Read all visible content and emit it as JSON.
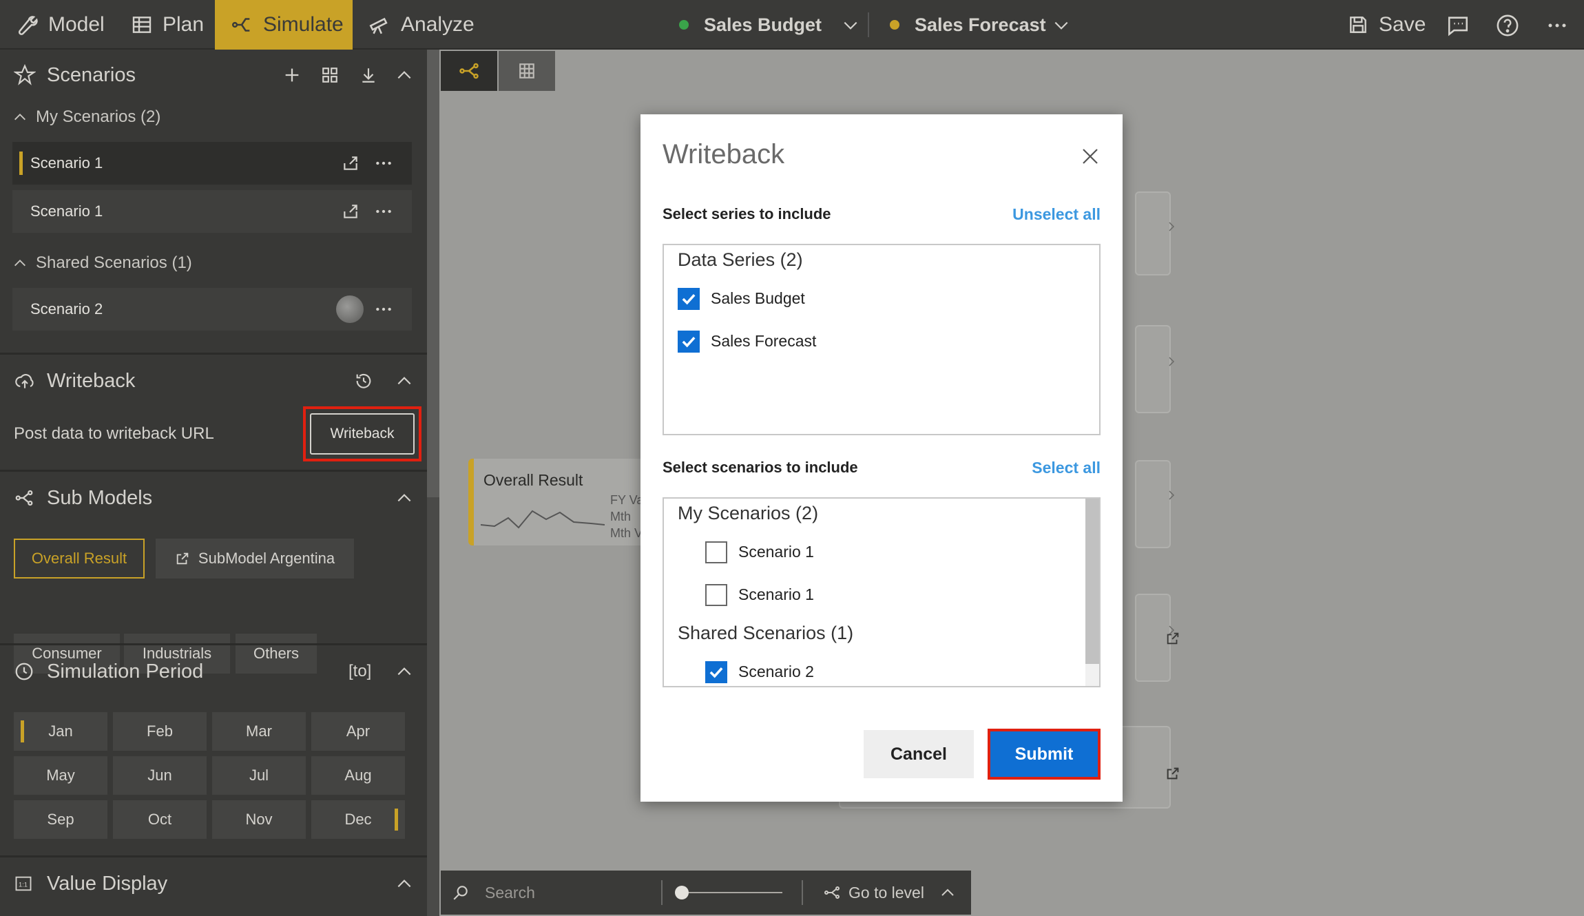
{
  "topbar": {
    "tabs": [
      {
        "label": "Model",
        "icon": "wrench-icon"
      },
      {
        "label": "Plan",
        "icon": "table-icon"
      },
      {
        "label": "Simulate",
        "icon": "simulate-icon",
        "active": true
      },
      {
        "label": "Analyze",
        "icon": "telescope-icon"
      }
    ],
    "series": [
      {
        "label": "Sales Budget",
        "color": "#3aa34a"
      },
      {
        "label": "Sales Forecast",
        "color": "#c9a227"
      }
    ],
    "save_label": "Save"
  },
  "sidebar": {
    "scenarios": {
      "title": "Scenarios",
      "my_group": "My Scenarios (2)",
      "my_items": [
        "Scenario 1",
        "Scenario 1"
      ],
      "shared_group": "Shared Scenarios (1)",
      "shared_items": [
        "Scenario 2"
      ]
    },
    "writeback": {
      "title": "Writeback",
      "description": "Post data to writeback URL",
      "button_label": "Writeback"
    },
    "submodels": {
      "title": "Sub Models",
      "items": [
        "Overall Result",
        "SubModel Argentina",
        "Consumer",
        "Industrials",
        "Others"
      ]
    },
    "period": {
      "title": "Simulation Period",
      "suffix": "[to]",
      "months": [
        "Jan",
        "Feb",
        "Mar",
        "Apr",
        "May",
        "Jun",
        "Jul",
        "Aug",
        "Sep",
        "Oct",
        "Nov",
        "Dec"
      ]
    },
    "value_display": {
      "title": "Value Display"
    }
  },
  "canvas": {
    "card_title": "Overall Result",
    "card_lines": [
      "FY Var",
      "Mth",
      "Mth Va"
    ]
  },
  "bottombar": {
    "search_placeholder": "Search",
    "goto_label": "Go to level"
  },
  "modal": {
    "title": "Writeback",
    "series_heading": "Select series to include",
    "series_link": "Unselect all",
    "series_group": "Data Series (2)",
    "series_items": [
      {
        "label": "Sales Budget",
        "checked": true
      },
      {
        "label": "Sales Forecast",
        "checked": true
      }
    ],
    "scenarios_heading": "Select scenarios to include",
    "scenarios_link": "Select all",
    "my_group": "My Scenarios (2)",
    "my_items": [
      {
        "label": "Scenario 1",
        "checked": false
      },
      {
        "label": "Scenario 1",
        "checked": false
      }
    ],
    "shared_group": "Shared Scenarios (1)",
    "shared_items": [
      {
        "label": "Scenario 2",
        "checked": true
      }
    ],
    "cancel_label": "Cancel",
    "submit_label": "Submit"
  }
}
